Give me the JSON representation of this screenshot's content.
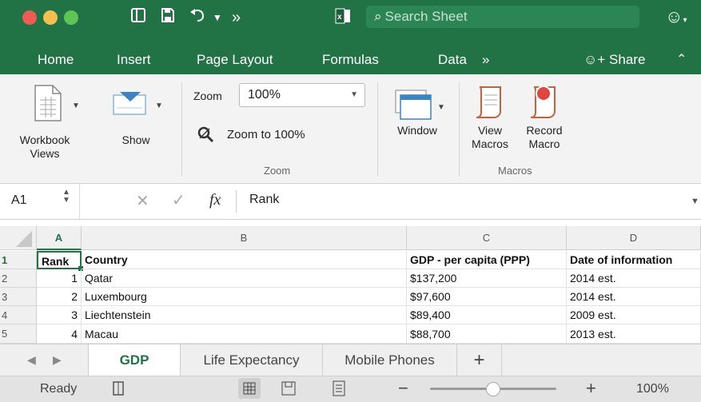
{
  "title_bar": {
    "search_placeholder": "Search Sheet",
    "icons": [
      "sidebar-icon",
      "save-icon",
      "undo-icon",
      "dropdown-icon",
      "more-icon",
      "excel-icon",
      "smiley-icon"
    ]
  },
  "ribbon_tabs": [
    "Home",
    "Insert",
    "Page Layout",
    "Formulas",
    "Data",
    "»"
  ],
  "share_label": "Share",
  "ribbon": {
    "workbook_views": "Workbook Views",
    "workbook_views_line1": "Workbook",
    "workbook_views_line2": "Views",
    "show": "Show",
    "zoom_label": "Zoom",
    "zoom_value": "100%",
    "zoom_to_100": "Zoom to 100%",
    "zoom_group": "Zoom",
    "window": "Window",
    "view_macros_line1": "View",
    "view_macros_line2": "Macros",
    "record_macro_line1": "Record",
    "record_macro_line2": "Macro",
    "macros_group": "Macros"
  },
  "formula_bar": {
    "name_box": "A1",
    "fx": "fx",
    "content": "Rank"
  },
  "columns": [
    "A",
    "B",
    "C",
    "D"
  ],
  "rows": [
    {
      "num": "1",
      "a": "Rank",
      "b": "Country",
      "c": "GDP - per capita (PPP)",
      "d": "Date of information"
    },
    {
      "num": "2",
      "a": "1",
      "b": "Qatar",
      "c": "$137,200",
      "d": "2014 est."
    },
    {
      "num": "3",
      "a": "2",
      "b": "Luxembourg",
      "c": "$97,600",
      "d": "2014 est."
    },
    {
      "num": "4",
      "a": "3",
      "b": "Liechtenstein",
      "c": "$89,400",
      "d": "2009 est."
    },
    {
      "num": "5",
      "a": "4",
      "b": "Macau",
      "c": "$88,700",
      "d": "2013 est."
    }
  ],
  "sheet_tabs": [
    "GDP",
    "Life Expectancy",
    "Mobile Phones"
  ],
  "active_sheet": "GDP",
  "status": {
    "ready": "Ready",
    "zoom": "100%",
    "zoom_slider_fraction": 0.5
  },
  "colors": {
    "accent": "#217346",
    "selection": "#217346"
  }
}
